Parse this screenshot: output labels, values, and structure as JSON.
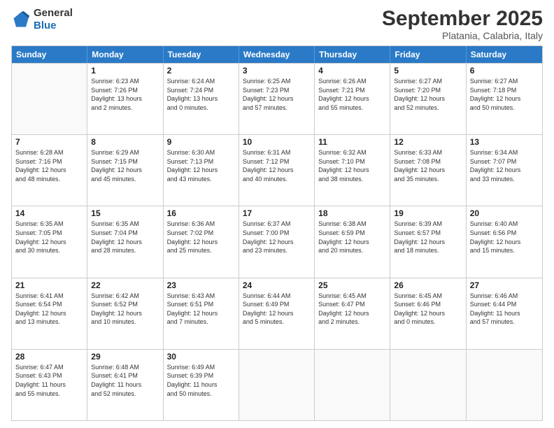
{
  "header": {
    "logo_line1": "General",
    "logo_line2": "Blue",
    "month": "September 2025",
    "location": "Platania, Calabria, Italy"
  },
  "days_of_week": [
    "Sunday",
    "Monday",
    "Tuesday",
    "Wednesday",
    "Thursday",
    "Friday",
    "Saturday"
  ],
  "weeks": [
    [
      {
        "day": "",
        "info": ""
      },
      {
        "day": "1",
        "info": "Sunrise: 6:23 AM\nSunset: 7:26 PM\nDaylight: 13 hours\nand 2 minutes."
      },
      {
        "day": "2",
        "info": "Sunrise: 6:24 AM\nSunset: 7:24 PM\nDaylight: 13 hours\nand 0 minutes."
      },
      {
        "day": "3",
        "info": "Sunrise: 6:25 AM\nSunset: 7:23 PM\nDaylight: 12 hours\nand 57 minutes."
      },
      {
        "day": "4",
        "info": "Sunrise: 6:26 AM\nSunset: 7:21 PM\nDaylight: 12 hours\nand 55 minutes."
      },
      {
        "day": "5",
        "info": "Sunrise: 6:27 AM\nSunset: 7:20 PM\nDaylight: 12 hours\nand 52 minutes."
      },
      {
        "day": "6",
        "info": "Sunrise: 6:27 AM\nSunset: 7:18 PM\nDaylight: 12 hours\nand 50 minutes."
      }
    ],
    [
      {
        "day": "7",
        "info": "Sunrise: 6:28 AM\nSunset: 7:16 PM\nDaylight: 12 hours\nand 48 minutes."
      },
      {
        "day": "8",
        "info": "Sunrise: 6:29 AM\nSunset: 7:15 PM\nDaylight: 12 hours\nand 45 minutes."
      },
      {
        "day": "9",
        "info": "Sunrise: 6:30 AM\nSunset: 7:13 PM\nDaylight: 12 hours\nand 43 minutes."
      },
      {
        "day": "10",
        "info": "Sunrise: 6:31 AM\nSunset: 7:12 PM\nDaylight: 12 hours\nand 40 minutes."
      },
      {
        "day": "11",
        "info": "Sunrise: 6:32 AM\nSunset: 7:10 PM\nDaylight: 12 hours\nand 38 minutes."
      },
      {
        "day": "12",
        "info": "Sunrise: 6:33 AM\nSunset: 7:08 PM\nDaylight: 12 hours\nand 35 minutes."
      },
      {
        "day": "13",
        "info": "Sunrise: 6:34 AM\nSunset: 7:07 PM\nDaylight: 12 hours\nand 33 minutes."
      }
    ],
    [
      {
        "day": "14",
        "info": "Sunrise: 6:35 AM\nSunset: 7:05 PM\nDaylight: 12 hours\nand 30 minutes."
      },
      {
        "day": "15",
        "info": "Sunrise: 6:35 AM\nSunset: 7:04 PM\nDaylight: 12 hours\nand 28 minutes."
      },
      {
        "day": "16",
        "info": "Sunrise: 6:36 AM\nSunset: 7:02 PM\nDaylight: 12 hours\nand 25 minutes."
      },
      {
        "day": "17",
        "info": "Sunrise: 6:37 AM\nSunset: 7:00 PM\nDaylight: 12 hours\nand 23 minutes."
      },
      {
        "day": "18",
        "info": "Sunrise: 6:38 AM\nSunset: 6:59 PM\nDaylight: 12 hours\nand 20 minutes."
      },
      {
        "day": "19",
        "info": "Sunrise: 6:39 AM\nSunset: 6:57 PM\nDaylight: 12 hours\nand 18 minutes."
      },
      {
        "day": "20",
        "info": "Sunrise: 6:40 AM\nSunset: 6:56 PM\nDaylight: 12 hours\nand 15 minutes."
      }
    ],
    [
      {
        "day": "21",
        "info": "Sunrise: 6:41 AM\nSunset: 6:54 PM\nDaylight: 12 hours\nand 13 minutes."
      },
      {
        "day": "22",
        "info": "Sunrise: 6:42 AM\nSunset: 6:52 PM\nDaylight: 12 hours\nand 10 minutes."
      },
      {
        "day": "23",
        "info": "Sunrise: 6:43 AM\nSunset: 6:51 PM\nDaylight: 12 hours\nand 7 minutes."
      },
      {
        "day": "24",
        "info": "Sunrise: 6:44 AM\nSunset: 6:49 PM\nDaylight: 12 hours\nand 5 minutes."
      },
      {
        "day": "25",
        "info": "Sunrise: 6:45 AM\nSunset: 6:47 PM\nDaylight: 12 hours\nand 2 minutes."
      },
      {
        "day": "26",
        "info": "Sunrise: 6:45 AM\nSunset: 6:46 PM\nDaylight: 12 hours\nand 0 minutes."
      },
      {
        "day": "27",
        "info": "Sunrise: 6:46 AM\nSunset: 6:44 PM\nDaylight: 11 hours\nand 57 minutes."
      }
    ],
    [
      {
        "day": "28",
        "info": "Sunrise: 6:47 AM\nSunset: 6:43 PM\nDaylight: 11 hours\nand 55 minutes."
      },
      {
        "day": "29",
        "info": "Sunrise: 6:48 AM\nSunset: 6:41 PM\nDaylight: 11 hours\nand 52 minutes."
      },
      {
        "day": "30",
        "info": "Sunrise: 6:49 AM\nSunset: 6:39 PM\nDaylight: 11 hours\nand 50 minutes."
      },
      {
        "day": "",
        "info": ""
      },
      {
        "day": "",
        "info": ""
      },
      {
        "day": "",
        "info": ""
      },
      {
        "day": "",
        "info": ""
      }
    ]
  ]
}
